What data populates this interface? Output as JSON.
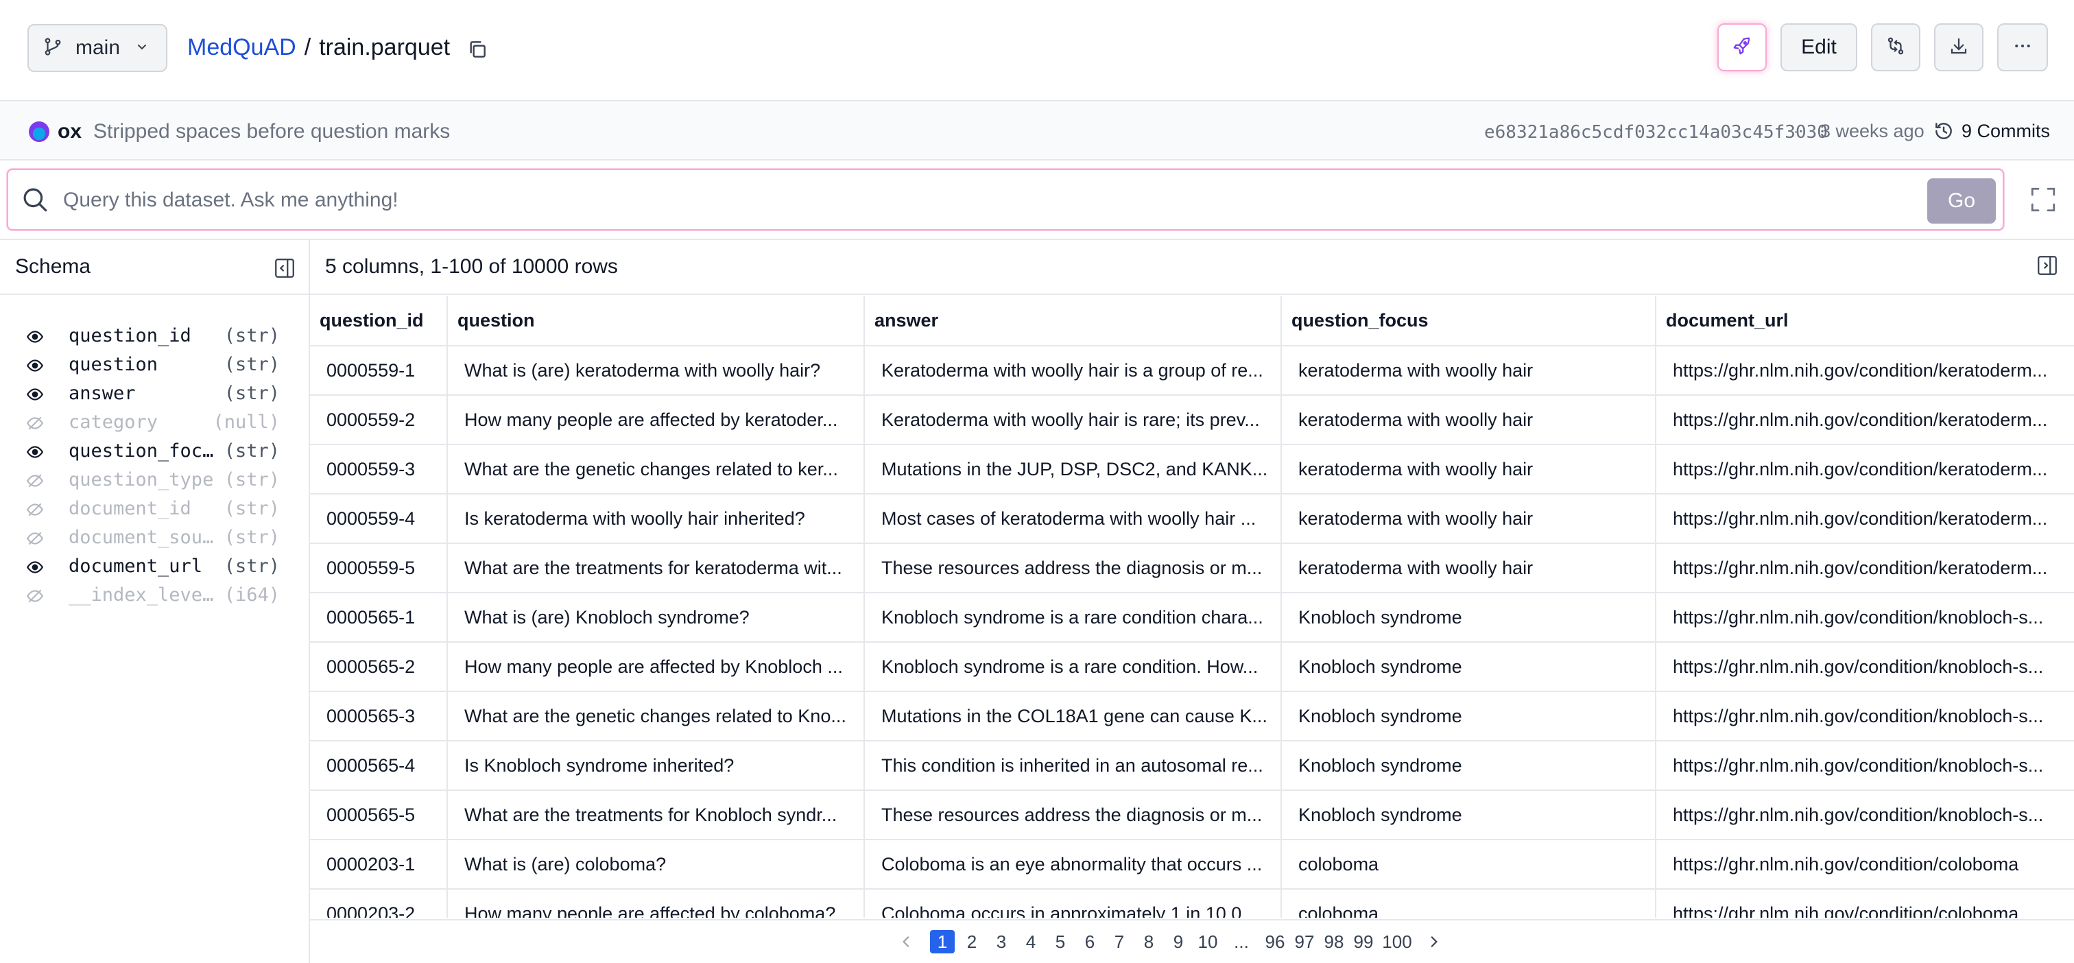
{
  "header": {
    "branch": "main",
    "repo": "MedQuAD",
    "separator": "/",
    "file": "train.parquet",
    "edit_label": "Edit"
  },
  "commit": {
    "author": "ox",
    "message": "Stripped spaces before question marks",
    "hash": "e68321a86c5cdf032cc14a03c45f3030",
    "dot": "·",
    "age": "3 weeks ago",
    "commits_label": "9 Commits"
  },
  "query": {
    "placeholder": "Query this dataset. Ask me anything!",
    "go_label": "Go"
  },
  "schema": {
    "title": "Schema",
    "fields": [
      {
        "name": "question_id",
        "type": "(str)",
        "visible": true
      },
      {
        "name": "question",
        "type": "(str)",
        "visible": true
      },
      {
        "name": "answer",
        "type": "(str)",
        "visible": true
      },
      {
        "name": "category",
        "type": "(null)",
        "visible": false
      },
      {
        "name": "question_focus",
        "type": "(str)",
        "visible": true
      },
      {
        "name": "question_type",
        "type": "(str)",
        "visible": false
      },
      {
        "name": "document_id",
        "type": "(str)",
        "visible": false
      },
      {
        "name": "document_sour…",
        "type": "(str)",
        "visible": false
      },
      {
        "name": "document_url",
        "type": "(str)",
        "visible": true
      },
      {
        "name": "__index_level…",
        "type": "(i64)",
        "visible": false
      }
    ]
  },
  "table": {
    "info": "5 columns, 1-100 of 10000 rows",
    "columns": [
      "question_id",
      "question",
      "answer",
      "question_focus",
      "document_url"
    ],
    "rows": [
      [
        "0000559-1",
        "What is (are) keratoderma with woolly hair?",
        "Keratoderma with woolly hair is a group of re...",
        "keratoderma with woolly hair",
        "https://ghr.nlm.nih.gov/condition/keratoderm..."
      ],
      [
        "0000559-2",
        "How many people are affected by keratoder...",
        "Keratoderma with woolly hair is rare; its prev...",
        "keratoderma with woolly hair",
        "https://ghr.nlm.nih.gov/condition/keratoderm..."
      ],
      [
        "0000559-3",
        "What are the genetic changes related to ker...",
        "Mutations in the JUP, DSP, DSC2, and KANK...",
        "keratoderma with woolly hair",
        "https://ghr.nlm.nih.gov/condition/keratoderm..."
      ],
      [
        "0000559-4",
        "Is keratoderma with woolly hair inherited?",
        "Most cases of keratoderma with woolly hair ...",
        "keratoderma with woolly hair",
        "https://ghr.nlm.nih.gov/condition/keratoderm..."
      ],
      [
        "0000559-5",
        "What are the treatments for keratoderma wit...",
        "These resources address the diagnosis or m...",
        "keratoderma with woolly hair",
        "https://ghr.nlm.nih.gov/condition/keratoderm..."
      ],
      [
        "0000565-1",
        "What is (are) Knobloch syndrome?",
        "Knobloch syndrome is a rare condition chara...",
        "Knobloch syndrome",
        "https://ghr.nlm.nih.gov/condition/knobloch-s..."
      ],
      [
        "0000565-2",
        "How many people are affected by Knobloch ...",
        "Knobloch syndrome is a rare condition. How...",
        "Knobloch syndrome",
        "https://ghr.nlm.nih.gov/condition/knobloch-s..."
      ],
      [
        "0000565-3",
        "What are the genetic changes related to Kno...",
        "Mutations in the COL18A1 gene can cause K...",
        "Knobloch syndrome",
        "https://ghr.nlm.nih.gov/condition/knobloch-s..."
      ],
      [
        "0000565-4",
        "Is Knobloch syndrome inherited?",
        "This condition is inherited in an autosomal re...",
        "Knobloch syndrome",
        "https://ghr.nlm.nih.gov/condition/knobloch-s..."
      ],
      [
        "0000565-5",
        "What are the treatments for Knobloch syndr...",
        "These resources address the diagnosis or m...",
        "Knobloch syndrome",
        "https://ghr.nlm.nih.gov/condition/knobloch-s..."
      ],
      [
        "0000203-1",
        "What is (are) coloboma?",
        "Coloboma is an eye abnormality that occurs ...",
        "coloboma",
        "https://ghr.nlm.nih.gov/condition/coloboma"
      ],
      [
        "0000203-2",
        "How many people are affected by coloboma?",
        "Coloboma occurs in approximately 1 in 10,0...",
        "coloboma",
        "https://ghr.nlm.nih.gov/condition/coloboma"
      ]
    ]
  },
  "pagination": {
    "current": "1",
    "pages": [
      "1",
      "2",
      "3",
      "4",
      "5",
      "6",
      "7",
      "8",
      "9",
      "10",
      "...",
      "96",
      "97",
      "98",
      "99",
      "100"
    ]
  },
  "colors": {
    "accent": "#2563eb",
    "repo_link": "#1d4ed8",
    "go_button": "#a5a1b8",
    "query_border": "#f9a8d4"
  },
  "icons": [
    "branch-icon",
    "chevron-down-icon",
    "copy-icon",
    "rocket-icon",
    "compare-icon",
    "download-icon",
    "more-icon",
    "history-icon",
    "search-icon",
    "fullscreen-icon",
    "sidebar-collapse-icon",
    "eye-icon",
    "eye-off-icon",
    "panel-icon",
    "chevron-left-icon",
    "chevron-right-icon"
  ]
}
